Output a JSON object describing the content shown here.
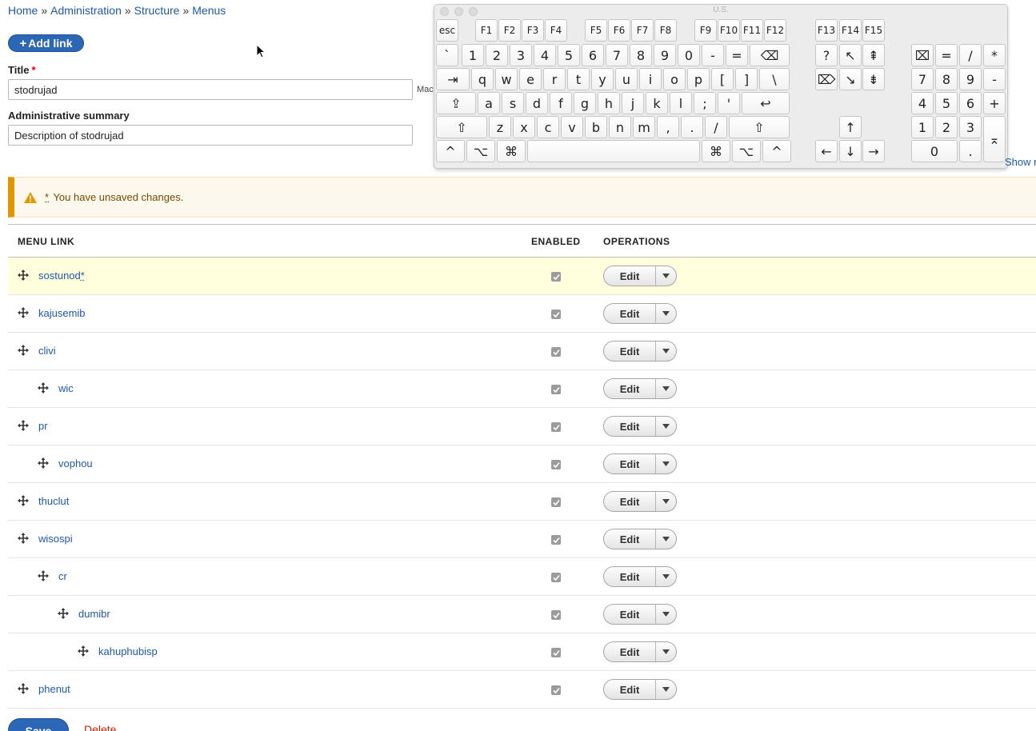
{
  "breadcrumb": {
    "items": [
      "Home",
      "Administration",
      "Structure",
      "Menus"
    ],
    "separator": "»"
  },
  "add_link": {
    "label": "Add link",
    "plus": "+"
  },
  "form": {
    "title_label": "Title",
    "required_mark": "*",
    "title_value": "stodrujad",
    "machine_name_prefix": "Mach",
    "summary_label": "Administrative summary",
    "summary_value": "Description of stodrujad"
  },
  "warning": {
    "star": "*",
    "message": " You have unsaved changes."
  },
  "table": {
    "headers": {
      "menu_link": "MENU LINK",
      "enabled": "ENABLED",
      "operations": "OPERATIONS"
    },
    "edit_label": "Edit",
    "rows": [
      {
        "label": "sostunod",
        "depth": 0,
        "changed": true,
        "star": "*"
      },
      {
        "label": "kajusemib",
        "depth": 0,
        "changed": false,
        "star": ""
      },
      {
        "label": "clivi",
        "depth": 0,
        "changed": false,
        "star": ""
      },
      {
        "label": "wic",
        "depth": 1,
        "changed": false,
        "star": ""
      },
      {
        "label": "pr",
        "depth": 0,
        "changed": false,
        "star": ""
      },
      {
        "label": "vophou",
        "depth": 1,
        "changed": false,
        "star": ""
      },
      {
        "label": "thuclut",
        "depth": 0,
        "changed": false,
        "star": ""
      },
      {
        "label": "wisospi",
        "depth": 0,
        "changed": false,
        "star": ""
      },
      {
        "label": "cr",
        "depth": 1,
        "changed": false,
        "star": ""
      },
      {
        "label": "dumibr",
        "depth": 2,
        "changed": false,
        "star": ""
      },
      {
        "label": "kahuphubisp",
        "depth": 3,
        "changed": false,
        "star": ""
      },
      {
        "label": "phenut",
        "depth": 0,
        "changed": false,
        "star": ""
      }
    ]
  },
  "actions": {
    "save": "Save",
    "delete": "Delete"
  },
  "keyboard": {
    "title": "U.S.",
    "show_label": "Show r",
    "keys": [
      [
        "esc",
        "F1",
        "F2",
        "F3",
        "F4",
        "F5",
        "F6",
        "F7",
        "F8",
        "F9",
        "F10",
        "F11",
        "F12",
        "F13",
        "F14",
        "F15"
      ],
      [
        "`",
        "1",
        "2",
        "3",
        "4",
        "5",
        "6",
        "7",
        "8",
        "9",
        "0",
        "-",
        "=",
        "⌫",
        "?",
        "↖",
        "⇞",
        "⌧",
        "=",
        "/",
        "*"
      ],
      [
        "⇥",
        "q",
        "w",
        "e",
        "r",
        "t",
        "y",
        "u",
        "i",
        "o",
        "p",
        "[",
        "]",
        "\\",
        "⌦",
        "↘",
        "⇟",
        "7",
        "8",
        "9",
        "-"
      ],
      [
        "⇪",
        "a",
        "s",
        "d",
        "f",
        "g",
        "h",
        "j",
        "k",
        "l",
        ";",
        "'",
        "↩",
        "4",
        "5",
        "6",
        "+"
      ],
      [
        "⇧",
        "z",
        "x",
        "c",
        "v",
        "b",
        "n",
        "m",
        ",",
        ".",
        "/",
        "⇧",
        "↑",
        "1",
        "2",
        "3",
        "⌅"
      ],
      [
        "^",
        "⌥",
        "⌘",
        "",
        "⌘",
        "⌥",
        "^",
        "←",
        "↓",
        "→",
        "0",
        "."
      ]
    ]
  },
  "colors": {
    "accent": "#2c67b5",
    "link": "#1f58a8",
    "warning": "#e09600",
    "changed_row": "#ffffdd",
    "delete": "#c41b00"
  }
}
